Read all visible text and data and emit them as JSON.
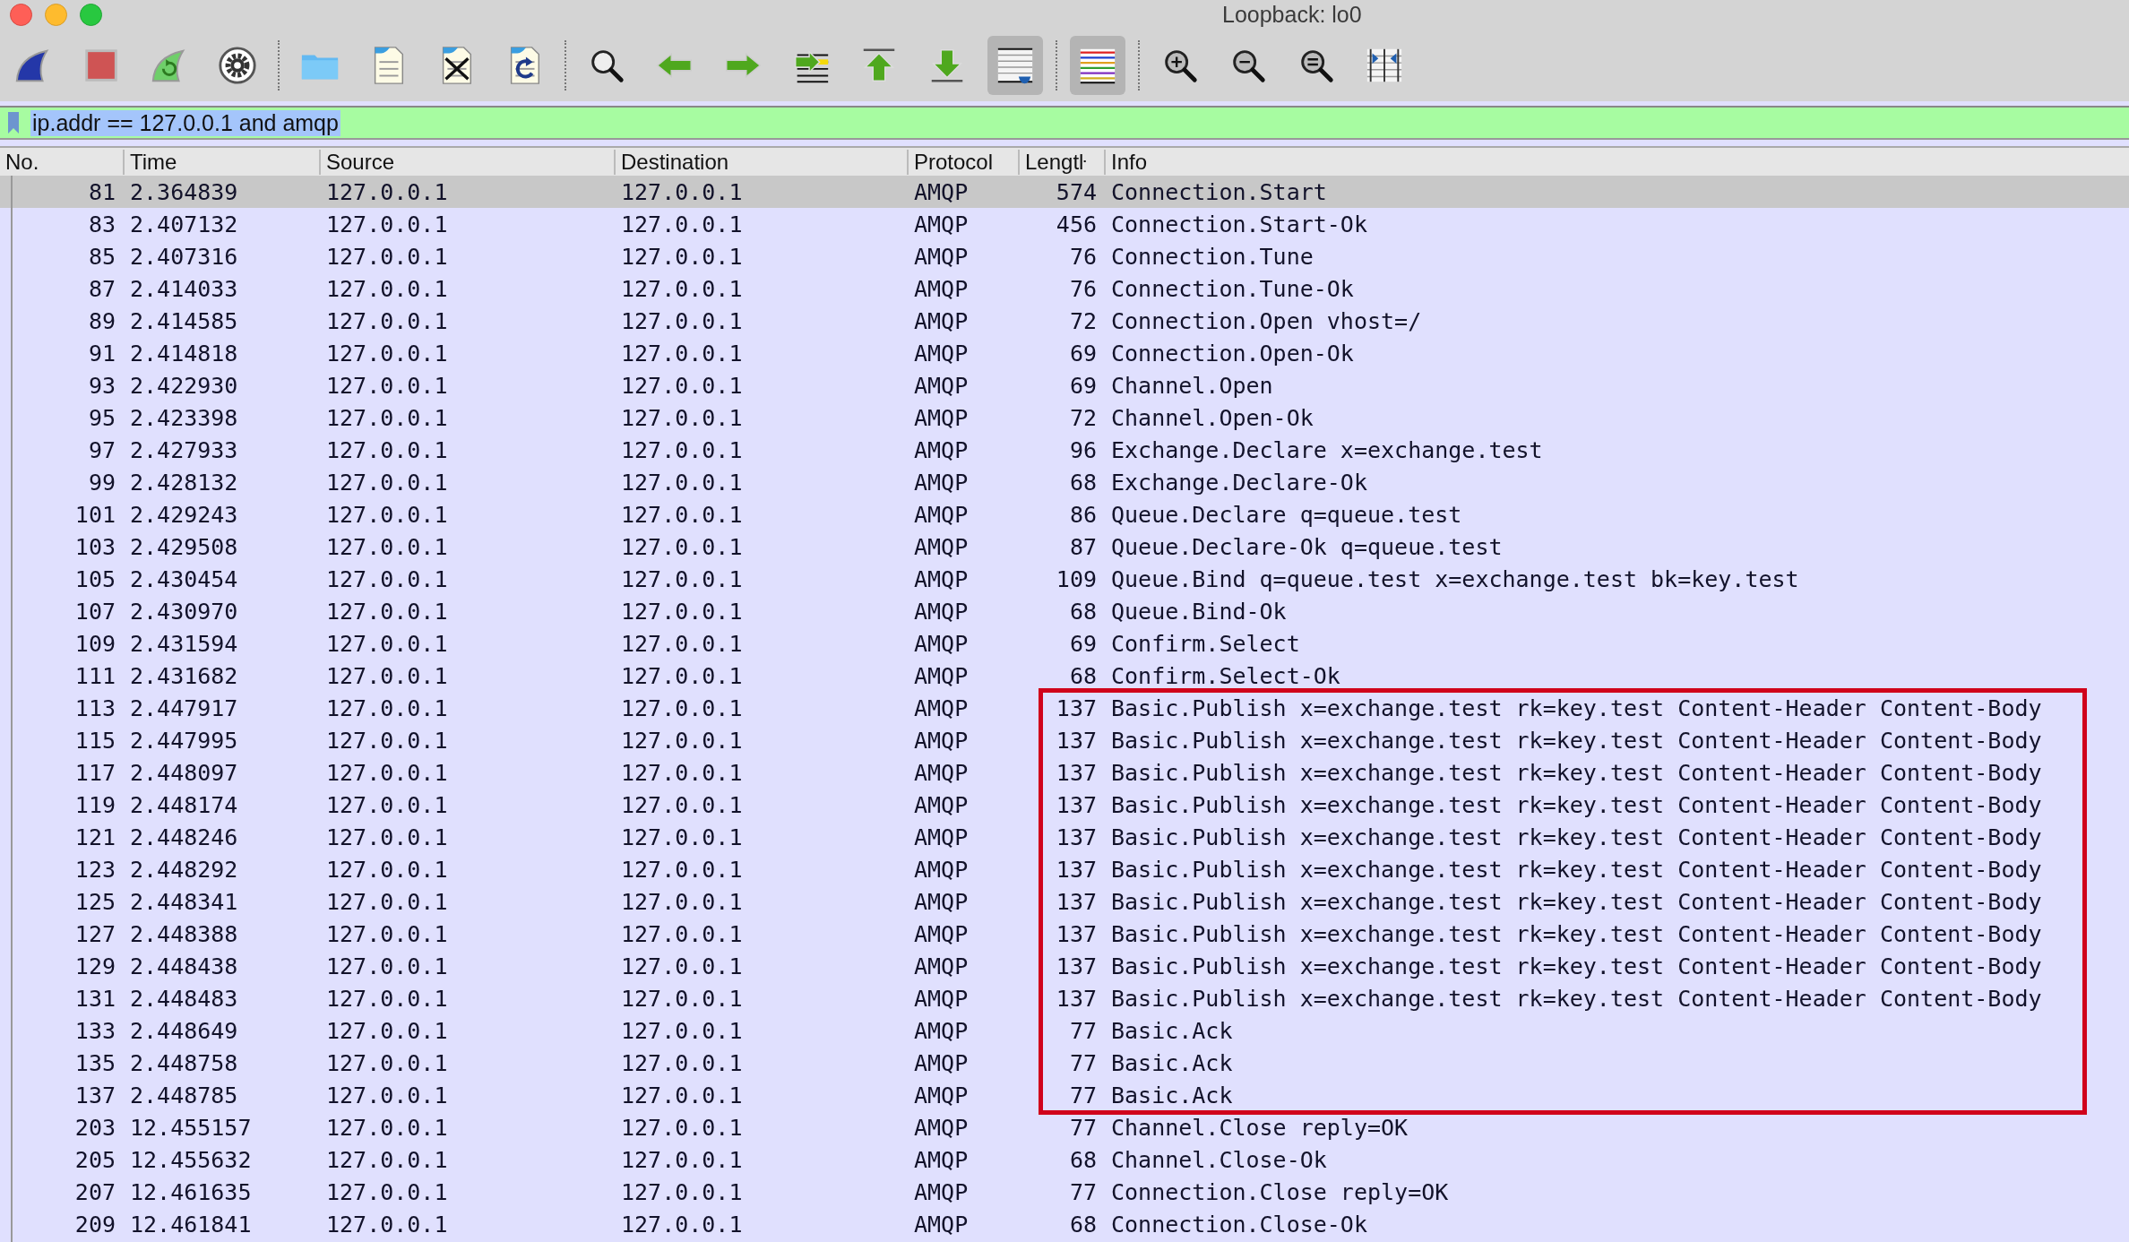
{
  "window": {
    "title": "Loopback: lo0"
  },
  "toolbar": [
    {
      "kind": "fin",
      "pressed": false
    },
    {
      "kind": "stop",
      "pressed": false
    },
    {
      "kind": "restart",
      "pressed": false
    },
    {
      "kind": "gear",
      "pressed": false
    },
    {
      "kind": "separator"
    },
    {
      "kind": "folder",
      "pressed": false
    },
    {
      "kind": "file",
      "pressed": false
    },
    {
      "kind": "file-close",
      "pressed": false
    },
    {
      "kind": "file-reload",
      "pressed": false
    },
    {
      "kind": "separator"
    },
    {
      "kind": "search",
      "pressed": false
    },
    {
      "kind": "back",
      "pressed": false
    },
    {
      "kind": "forward",
      "pressed": false
    },
    {
      "kind": "goto",
      "pressed": false
    },
    {
      "kind": "first",
      "pressed": false
    },
    {
      "kind": "last",
      "pressed": false
    },
    {
      "kind": "autoscroll",
      "pressed": true
    },
    {
      "kind": "separator"
    },
    {
      "kind": "colorize",
      "pressed": true
    },
    {
      "kind": "separator"
    },
    {
      "kind": "zoom-in",
      "pressed": false
    },
    {
      "kind": "zoom-out",
      "pressed": false
    },
    {
      "kind": "zoom-reset",
      "pressed": false
    },
    {
      "kind": "resize-columns",
      "pressed": false
    }
  ],
  "filter": {
    "value": "ip.addr == 127.0.0.1 and amqp",
    "selected": true
  },
  "table": {
    "columns": [
      "No.",
      "Time",
      "Source",
      "Destination",
      "Protocol",
      "Lengtŀ",
      "Info"
    ],
    "rows": [
      {
        "no": "81",
        "time": "2.364839",
        "source": "127.0.0.1",
        "destination": "127.0.0.1",
        "protocol": "AMQP",
        "length": "574",
        "info": "Connection.Start",
        "selected": true,
        "annotated": false
      },
      {
        "no": "83",
        "time": "2.407132",
        "source": "127.0.0.1",
        "destination": "127.0.0.1",
        "protocol": "AMQP",
        "length": "456",
        "info": "Connection.Start-Ok",
        "selected": false,
        "annotated": false
      },
      {
        "no": "85",
        "time": "2.407316",
        "source": "127.0.0.1",
        "destination": "127.0.0.1",
        "protocol": "AMQP",
        "length": "76",
        "info": "Connection.Tune",
        "selected": false,
        "annotated": false
      },
      {
        "no": "87",
        "time": "2.414033",
        "source": "127.0.0.1",
        "destination": "127.0.0.1",
        "protocol": "AMQP",
        "length": "76",
        "info": "Connection.Tune-Ok",
        "selected": false,
        "annotated": false
      },
      {
        "no": "89",
        "time": "2.414585",
        "source": "127.0.0.1",
        "destination": "127.0.0.1",
        "protocol": "AMQP",
        "length": "72",
        "info": "Connection.Open vhost=/",
        "selected": false,
        "annotated": false
      },
      {
        "no": "91",
        "time": "2.414818",
        "source": "127.0.0.1",
        "destination": "127.0.0.1",
        "protocol": "AMQP",
        "length": "69",
        "info": "Connection.Open-Ok",
        "selected": false,
        "annotated": false
      },
      {
        "no": "93",
        "time": "2.422930",
        "source": "127.0.0.1",
        "destination": "127.0.0.1",
        "protocol": "AMQP",
        "length": "69",
        "info": "Channel.Open",
        "selected": false,
        "annotated": false
      },
      {
        "no": "95",
        "time": "2.423398",
        "source": "127.0.0.1",
        "destination": "127.0.0.1",
        "protocol": "AMQP",
        "length": "72",
        "info": "Channel.Open-Ok",
        "selected": false,
        "annotated": false
      },
      {
        "no": "97",
        "time": "2.427933",
        "source": "127.0.0.1",
        "destination": "127.0.0.1",
        "protocol": "AMQP",
        "length": "96",
        "info": "Exchange.Declare x=exchange.test",
        "selected": false,
        "annotated": false
      },
      {
        "no": "99",
        "time": "2.428132",
        "source": "127.0.0.1",
        "destination": "127.0.0.1",
        "protocol": "AMQP",
        "length": "68",
        "info": "Exchange.Declare-Ok",
        "selected": false,
        "annotated": false
      },
      {
        "no": "101",
        "time": "2.429243",
        "source": "127.0.0.1",
        "destination": "127.0.0.1",
        "protocol": "AMQP",
        "length": "86",
        "info": "Queue.Declare q=queue.test",
        "selected": false,
        "annotated": false
      },
      {
        "no": "103",
        "time": "2.429508",
        "source": "127.0.0.1",
        "destination": "127.0.0.1",
        "protocol": "AMQP",
        "length": "87",
        "info": "Queue.Declare-Ok q=queue.test",
        "selected": false,
        "annotated": false
      },
      {
        "no": "105",
        "time": "2.430454",
        "source": "127.0.0.1",
        "destination": "127.0.0.1",
        "protocol": "AMQP",
        "length": "109",
        "info": "Queue.Bind q=queue.test x=exchange.test bk=key.test",
        "selected": false,
        "annotated": false
      },
      {
        "no": "107",
        "time": "2.430970",
        "source": "127.0.0.1",
        "destination": "127.0.0.1",
        "protocol": "AMQP",
        "length": "68",
        "info": "Queue.Bind-Ok",
        "selected": false,
        "annotated": false
      },
      {
        "no": "109",
        "time": "2.431594",
        "source": "127.0.0.1",
        "destination": "127.0.0.1",
        "protocol": "AMQP",
        "length": "69",
        "info": "Confirm.Select",
        "selected": false,
        "annotated": false
      },
      {
        "no": "111",
        "time": "2.431682",
        "source": "127.0.0.1",
        "destination": "127.0.0.1",
        "protocol": "AMQP",
        "length": "68",
        "info": "Confirm.Select-Ok",
        "selected": false,
        "annotated": false
      },
      {
        "no": "113",
        "time": "2.447917",
        "source": "127.0.0.1",
        "destination": "127.0.0.1",
        "protocol": "AMQP",
        "length": "137",
        "info": "Basic.Publish x=exchange.test rk=key.test Content-Header Content-Body",
        "selected": false,
        "annotated": true
      },
      {
        "no": "115",
        "time": "2.447995",
        "source": "127.0.0.1",
        "destination": "127.0.0.1",
        "protocol": "AMQP",
        "length": "137",
        "info": "Basic.Publish x=exchange.test rk=key.test Content-Header Content-Body",
        "selected": false,
        "annotated": true
      },
      {
        "no": "117",
        "time": "2.448097",
        "source": "127.0.0.1",
        "destination": "127.0.0.1",
        "protocol": "AMQP",
        "length": "137",
        "info": "Basic.Publish x=exchange.test rk=key.test Content-Header Content-Body",
        "selected": false,
        "annotated": true
      },
      {
        "no": "119",
        "time": "2.448174",
        "source": "127.0.0.1",
        "destination": "127.0.0.1",
        "protocol": "AMQP",
        "length": "137",
        "info": "Basic.Publish x=exchange.test rk=key.test Content-Header Content-Body",
        "selected": false,
        "annotated": true
      },
      {
        "no": "121",
        "time": "2.448246",
        "source": "127.0.0.1",
        "destination": "127.0.0.1",
        "protocol": "AMQP",
        "length": "137",
        "info": "Basic.Publish x=exchange.test rk=key.test Content-Header Content-Body",
        "selected": false,
        "annotated": true
      },
      {
        "no": "123",
        "time": "2.448292",
        "source": "127.0.0.1",
        "destination": "127.0.0.1",
        "protocol": "AMQP",
        "length": "137",
        "info": "Basic.Publish x=exchange.test rk=key.test Content-Header Content-Body",
        "selected": false,
        "annotated": true
      },
      {
        "no": "125",
        "time": "2.448341",
        "source": "127.0.0.1",
        "destination": "127.0.0.1",
        "protocol": "AMQP",
        "length": "137",
        "info": "Basic.Publish x=exchange.test rk=key.test Content-Header Content-Body",
        "selected": false,
        "annotated": true
      },
      {
        "no": "127",
        "time": "2.448388",
        "source": "127.0.0.1",
        "destination": "127.0.0.1",
        "protocol": "AMQP",
        "length": "137",
        "info": "Basic.Publish x=exchange.test rk=key.test Content-Header Content-Body",
        "selected": false,
        "annotated": true
      },
      {
        "no": "129",
        "time": "2.448438",
        "source": "127.0.0.1",
        "destination": "127.0.0.1",
        "protocol": "AMQP",
        "length": "137",
        "info": "Basic.Publish x=exchange.test rk=key.test Content-Header Content-Body",
        "selected": false,
        "annotated": true
      },
      {
        "no": "131",
        "time": "2.448483",
        "source": "127.0.0.1",
        "destination": "127.0.0.1",
        "protocol": "AMQP",
        "length": "137",
        "info": "Basic.Publish x=exchange.test rk=key.test Content-Header Content-Body",
        "selected": false,
        "annotated": true
      },
      {
        "no": "133",
        "time": "2.448649",
        "source": "127.0.0.1",
        "destination": "127.0.0.1",
        "protocol": "AMQP",
        "length": "77",
        "info": "Basic.Ack",
        "selected": false,
        "annotated": true
      },
      {
        "no": "135",
        "time": "2.448758",
        "source": "127.0.0.1",
        "destination": "127.0.0.1",
        "protocol": "AMQP",
        "length": "77",
        "info": "Basic.Ack",
        "selected": false,
        "annotated": true
      },
      {
        "no": "137",
        "time": "2.448785",
        "source": "127.0.0.1",
        "destination": "127.0.0.1",
        "protocol": "AMQP",
        "length": "77",
        "info": "Basic.Ack",
        "selected": false,
        "annotated": true
      },
      {
        "no": "203",
        "time": "12.455157",
        "source": "127.0.0.1",
        "destination": "127.0.0.1",
        "protocol": "AMQP",
        "length": "77",
        "info": "Channel.Close reply=OK",
        "selected": false,
        "annotated": false
      },
      {
        "no": "205",
        "time": "12.455632",
        "source": "127.0.0.1",
        "destination": "127.0.0.1",
        "protocol": "AMQP",
        "length": "68",
        "info": "Channel.Close-Ok",
        "selected": false,
        "annotated": false
      },
      {
        "no": "207",
        "time": "12.461635",
        "source": "127.0.0.1",
        "destination": "127.0.0.1",
        "protocol": "AMQP",
        "length": "77",
        "info": "Connection.Close reply=OK",
        "selected": false,
        "annotated": false
      },
      {
        "no": "209",
        "time": "12.461841",
        "source": "127.0.0.1",
        "destination": "127.0.0.1",
        "protocol": "AMQP",
        "length": "68",
        "info": "Connection.Close-Ok",
        "selected": false,
        "annotated": false
      }
    ]
  }
}
